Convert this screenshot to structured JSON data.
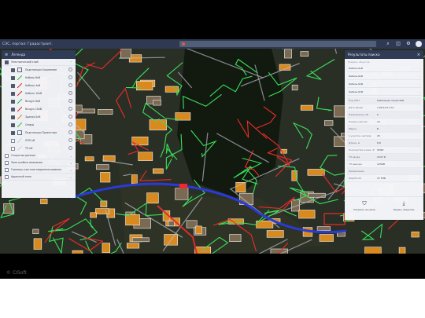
{
  "app": {
    "title": "СЭС, портал: Градостроит."
  },
  "search": {
    "placeholder": "Поиск на карте или по адресу"
  },
  "header_icons": [
    "search-icon",
    "layers-icon",
    "gear-icon",
    "user-icon"
  ],
  "legend": {
    "title": "Легенда",
    "groups": [
      {
        "label": "Электрический слой",
        "checked": true
      },
      {
        "label": "Открытые данные",
        "checked": false
      },
      {
        "label": "Зона особого внимания",
        "checked": false
      },
      {
        "label": "Границы участков недропользования",
        "checked": false
      },
      {
        "label": "Адресный план",
        "checked": false
      }
    ],
    "layers": [
      {
        "label": "Подстанции Охранение",
        "checked": true,
        "color": "#5a6a88",
        "symbol": "square"
      },
      {
        "label": "Кабель 6кВ",
        "checked": true,
        "color": "#2fbf4a",
        "symbol": "line"
      },
      {
        "label": "Кабель 4кВ",
        "checked": true,
        "color": "#e02b2b",
        "symbol": "line"
      },
      {
        "label": "Кабель 10кВ",
        "checked": true,
        "color": "#e02b2b",
        "symbol": "line"
      },
      {
        "label": "Воздух 6кВ",
        "checked": true,
        "color": "#2fbf4a",
        "symbol": "line"
      },
      {
        "label": "Воздух 10кВ",
        "checked": true,
        "color": "#e02b2b",
        "symbol": "line"
      },
      {
        "label": "Здания 0кВ",
        "checked": true,
        "color": "#e08a2b",
        "symbol": "line"
      },
      {
        "label": "Опоры",
        "checked": true,
        "color": "#2fbf4a",
        "symbol": "line"
      },
      {
        "label": "Подстанции Проектные",
        "checked": true,
        "color": "#5a6a88",
        "symbol": "square"
      },
      {
        "label": "ЛЭП кВ",
        "checked": false,
        "color": "#d0d3da",
        "symbol": "line"
      },
      {
        "label": "ТП кВ",
        "checked": false,
        "color": "#d0d3da",
        "symbol": "line"
      }
    ]
  },
  "results": {
    "title": "Результаты поиска",
    "subtitle": "Найдено объектов",
    "items": [
      "Кабель 6кВ",
      "Кабель 6кВ",
      "Кабель 6кВ",
      "Кабель 6кВ"
    ],
    "fields": [
      {
        "k": "Код ЛЭП",
        "v": "Кабельная линия 6кВ"
      },
      {
        "k": "Дата ввода",
        "v": "1.06.12.0.174"
      },
      {
        "k": "Напряжение кВ",
        "v": "6"
      },
      {
        "k": "Номер участка",
        "v": "10"
      },
      {
        "k": "Марка",
        "v": "Б"
      },
      {
        "k": "L участка, метров",
        "v": "25"
      },
      {
        "k": "Длина, м",
        "v": "6.8"
      },
      {
        "k": "Количество ячеек, Ф",
        "v": "ЛУЯЛ"
      },
      {
        "k": "ТП ввода",
        "v": "2347 Ф"
      },
      {
        "k": "ТП вывода",
        "v": "1254Ф"
      },
      {
        "k": "Примечание",
        "v": ""
      },
      {
        "k": "Фид № кВ",
        "v": "37 5ПВ"
      }
    ],
    "actions": [
      {
        "label": "Показать на карте",
        "icon": "person-pin-icon"
      },
      {
        "label": "Назад к объектам",
        "icon": "download-icon"
      }
    ]
  },
  "map": {
    "scale_label": "50 м"
  },
  "footer": {
    "copyright": "© CISoft"
  }
}
